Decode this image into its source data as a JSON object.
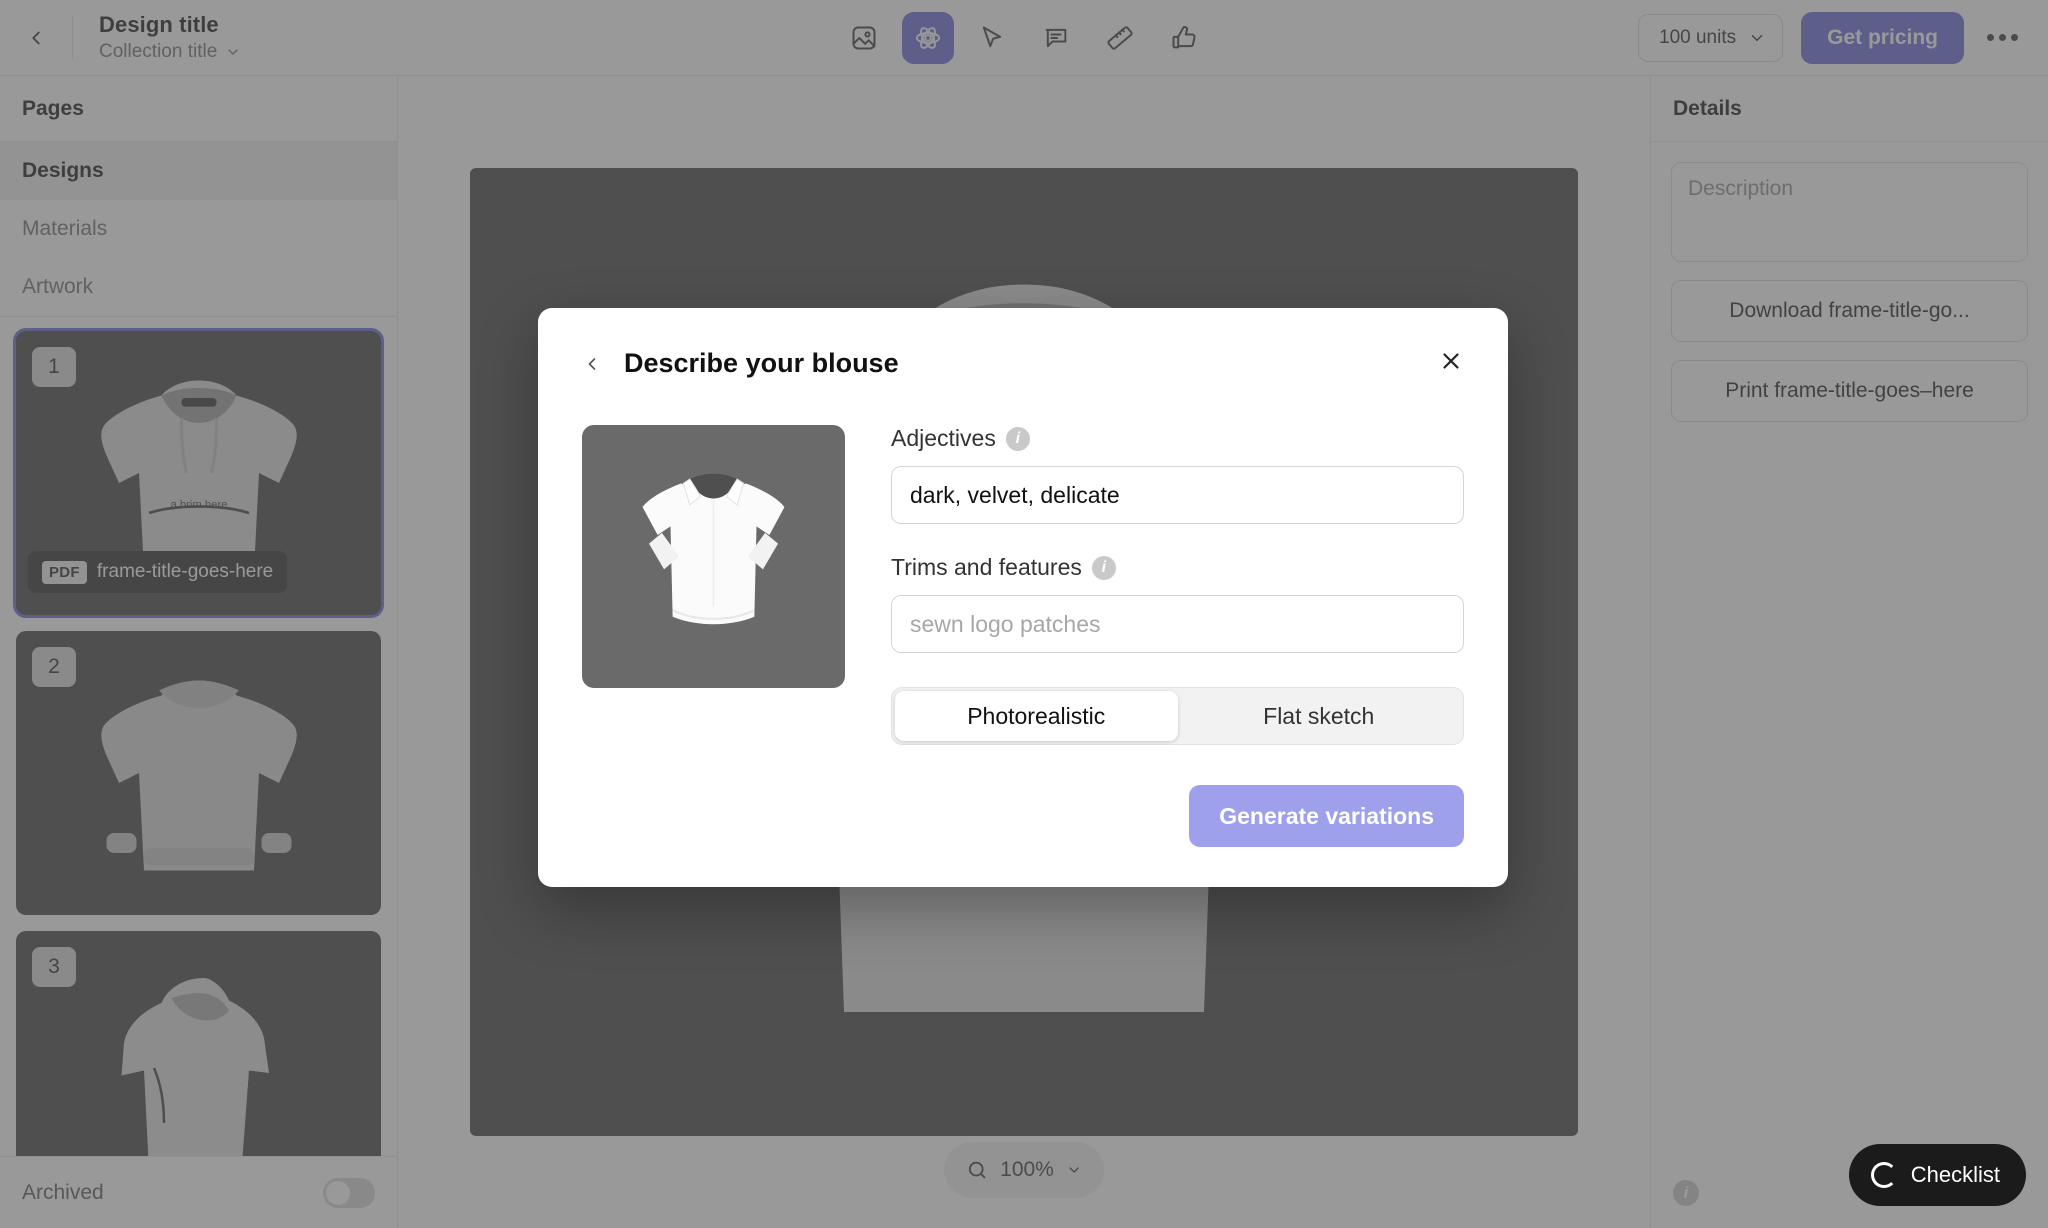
{
  "header": {
    "back_icon": "chevron-left-icon",
    "title": "Design title",
    "subtitle": "Collection title",
    "subtitle_caret": "chevron-down-icon",
    "tools": [
      {
        "name": "image-icon",
        "label": "Image",
        "active": false
      },
      {
        "name": "ai-atom-icon",
        "label": "AI",
        "active": true
      },
      {
        "name": "cursor-icon",
        "label": "Select",
        "active": false
      },
      {
        "name": "comment-icon",
        "label": "Comment",
        "active": false
      },
      {
        "name": "ruler-icon",
        "label": "Measure",
        "active": false
      },
      {
        "name": "thumbs-up-icon",
        "label": "Approve",
        "active": false
      }
    ],
    "units_value": "100 units",
    "pricing_label": "Get pricing",
    "more_icon": "kebab-menu-icon"
  },
  "sidebar": {
    "heading": "Pages",
    "nav": [
      {
        "label": "Designs",
        "active": true
      },
      {
        "label": "Materials",
        "active": false
      },
      {
        "label": "Artwork",
        "active": false
      }
    ],
    "thumbs": [
      {
        "number": "1",
        "selected": true,
        "badge_tag": "PDF",
        "badge_name": "frame-title-goes-here"
      },
      {
        "number": "2",
        "selected": false
      },
      {
        "number": "3",
        "selected": false
      }
    ],
    "archived_label": "Archived",
    "archived_on": false
  },
  "canvas": {
    "zoom_icon": "search-icon",
    "zoom_value": "100%",
    "zoom_caret": "chevron-down-icon"
  },
  "details": {
    "heading": "Details",
    "description_placeholder": "Description",
    "buttons": [
      {
        "label": "Download frame-title-go..."
      },
      {
        "label": "Print frame-title-goes–here"
      }
    ],
    "info_icon": "info-icon"
  },
  "checklist": {
    "icon": "loading-spinner-icon",
    "label": "Checklist"
  },
  "modal": {
    "back_icon": "chevron-left-icon",
    "title": "Describe your blouse",
    "close_icon": "close-icon",
    "preview_name": "blouse-preview-image",
    "adjectives": {
      "label": "Adjectives",
      "info_icon": "info-icon",
      "value": "dark, velvet, delicate",
      "placeholder": "dark, velvet, delicate"
    },
    "trims": {
      "label": "Trims and features",
      "info_icon": "info-icon",
      "value": "",
      "placeholder": "sewn logo patches"
    },
    "style_options": [
      {
        "label": "Photorealistic",
        "active": true
      },
      {
        "label": "Flat sketch",
        "active": false
      }
    ],
    "submit_label": "Generate variations"
  },
  "colors": {
    "accent": "#6366d8",
    "accent_muted": "#9ea0ec",
    "stage": "#3d3d3d",
    "dim": "rgba(90,90,90,0.62)"
  }
}
